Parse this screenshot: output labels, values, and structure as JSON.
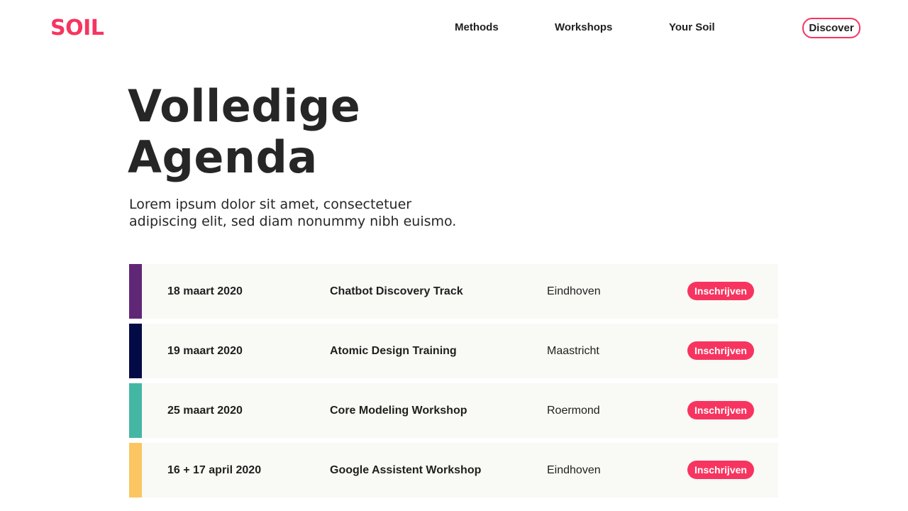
{
  "header": {
    "logo": "SOIL",
    "nav": [
      "Methods",
      "Workshops",
      "Your Soil"
    ],
    "discover_label": "Discover"
  },
  "hero": {
    "title_line1": "Volledige",
    "title_line2": "Agenda",
    "intro_line1": "Lorem ipsum dolor sit amet, consectetuer",
    "intro_line2": "adipiscing elit, sed diam nonummy nibh euismo."
  },
  "agenda": {
    "button_label": "Inschrijven",
    "rows": [
      {
        "date": "18 maart 2020",
        "name": "Chatbot Discovery Track",
        "city": "Eindhoven",
        "color": "#612777"
      },
      {
        "date": "19 maart 2020",
        "name": "Atomic Design Training",
        "city": "Maastricht",
        "color": "#020b46"
      },
      {
        "date": "25 maart 2020",
        "name": "Core Modeling Workshop",
        "city": "Roermond",
        "color": "#43b7a4"
      },
      {
        "date": "16 + 17 april 2020",
        "name": "Google Assistent Workshop",
        "city": "Eindhoven",
        "color": "#fbc661"
      }
    ]
  },
  "colors": {
    "accent": "#f7345f",
    "row_background": "#f9f9f5",
    "text": "#262626"
  }
}
